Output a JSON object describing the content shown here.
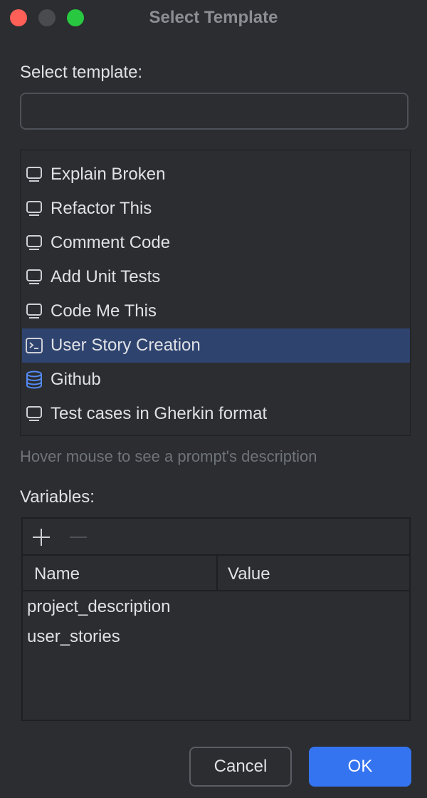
{
  "window": {
    "title": "Select Template"
  },
  "template_section": {
    "label": "Select template:",
    "search_value": "",
    "items": [
      {
        "label": "Explain Broken",
        "icon": "monitor-icon",
        "selected": false
      },
      {
        "label": "Refactor This",
        "icon": "monitor-icon",
        "selected": false
      },
      {
        "label": "Comment Code",
        "icon": "monitor-icon",
        "selected": false
      },
      {
        "label": "Add Unit Tests",
        "icon": "monitor-icon",
        "selected": false
      },
      {
        "label": "Code Me This",
        "icon": "monitor-icon",
        "selected": false
      },
      {
        "label": "User Story Creation",
        "icon": "terminal-icon",
        "selected": true
      },
      {
        "label": "Github",
        "icon": "database-icon",
        "selected": false
      },
      {
        "label": "Test cases in Gherkin format",
        "icon": "monitor-icon",
        "selected": false
      }
    ],
    "hint": "Hover mouse to see a prompt's description"
  },
  "variables_section": {
    "label": "Variables:",
    "columns": {
      "name": "Name",
      "value": "Value"
    },
    "rows": [
      {
        "name": "project_description",
        "value": ""
      },
      {
        "name": "user_stories",
        "value": ""
      }
    ]
  },
  "buttons": {
    "cancel": "Cancel",
    "ok": "OK"
  },
  "colors": {
    "background": "#2b2d30",
    "selection": "#2e436e",
    "accent": "#3574f0",
    "database_icon": "#548af7"
  }
}
